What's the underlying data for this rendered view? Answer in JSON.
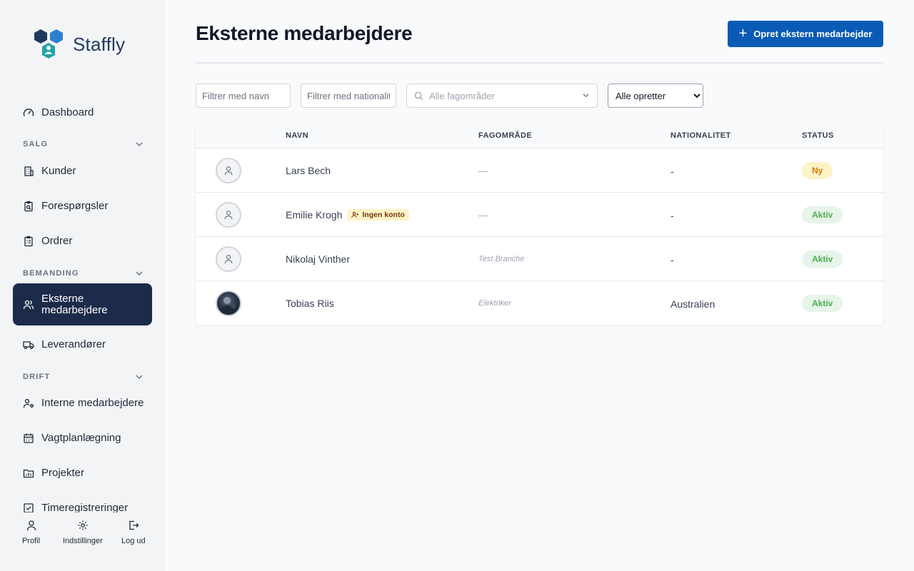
{
  "app": {
    "name": "Staffly"
  },
  "sidebar": {
    "dashboard": "Dashboard",
    "sections": {
      "salg": "SALG",
      "bemanding": "BEMANDING",
      "drift": "DRIFT"
    },
    "items": {
      "kunder": "Kunder",
      "forespoergsler": "Forespørgsler",
      "ordrer": "Ordrer",
      "eksterne": "Eksterne medarbejdere",
      "leverandoerer": "Leverandører",
      "interne": "Interne medarbejdere",
      "vagtplan": "Vagtplanlægning",
      "projekter": "Projekter",
      "timer": "Timeregistreringer"
    },
    "footer": {
      "profil": "Profil",
      "indstillinger": "Indstillinger",
      "logud": "Log ud"
    }
  },
  "page": {
    "title": "Eksterne medarbejdere",
    "create_button": "Opret ekstern medarbejder"
  },
  "filters": {
    "name_placeholder": "Filtrer med navn",
    "nationality_placeholder": "Filtrer med nationalitet",
    "area_placeholder": "Alle fagområder",
    "creator_selected": "Alle opretter"
  },
  "table": {
    "columns": [
      "NAVN",
      "FAGOMRÅDE",
      "NATIONALITET",
      "STATUS"
    ],
    "no_account_label": "Ingen konto",
    "rows": [
      {
        "name": "Lars Bech",
        "area": "—",
        "nationality": "-",
        "status": "Ny"
      },
      {
        "name": "Emilie Krogh",
        "area": "—",
        "nationality": "-",
        "status": "Aktiv"
      },
      {
        "name": "Nikolaj Vinther",
        "area": "Test Branche",
        "nationality": "-",
        "status": "Aktiv"
      },
      {
        "name": "Tobias Riis",
        "area": "Elektriker",
        "nationality": "Australien",
        "status": "Aktiv"
      }
    ]
  },
  "colors": {
    "primary": "#0a5bb5",
    "sidebar_active": "#1c2b4a",
    "status_ny": "#d97706",
    "status_aktiv": "#4caf50"
  }
}
